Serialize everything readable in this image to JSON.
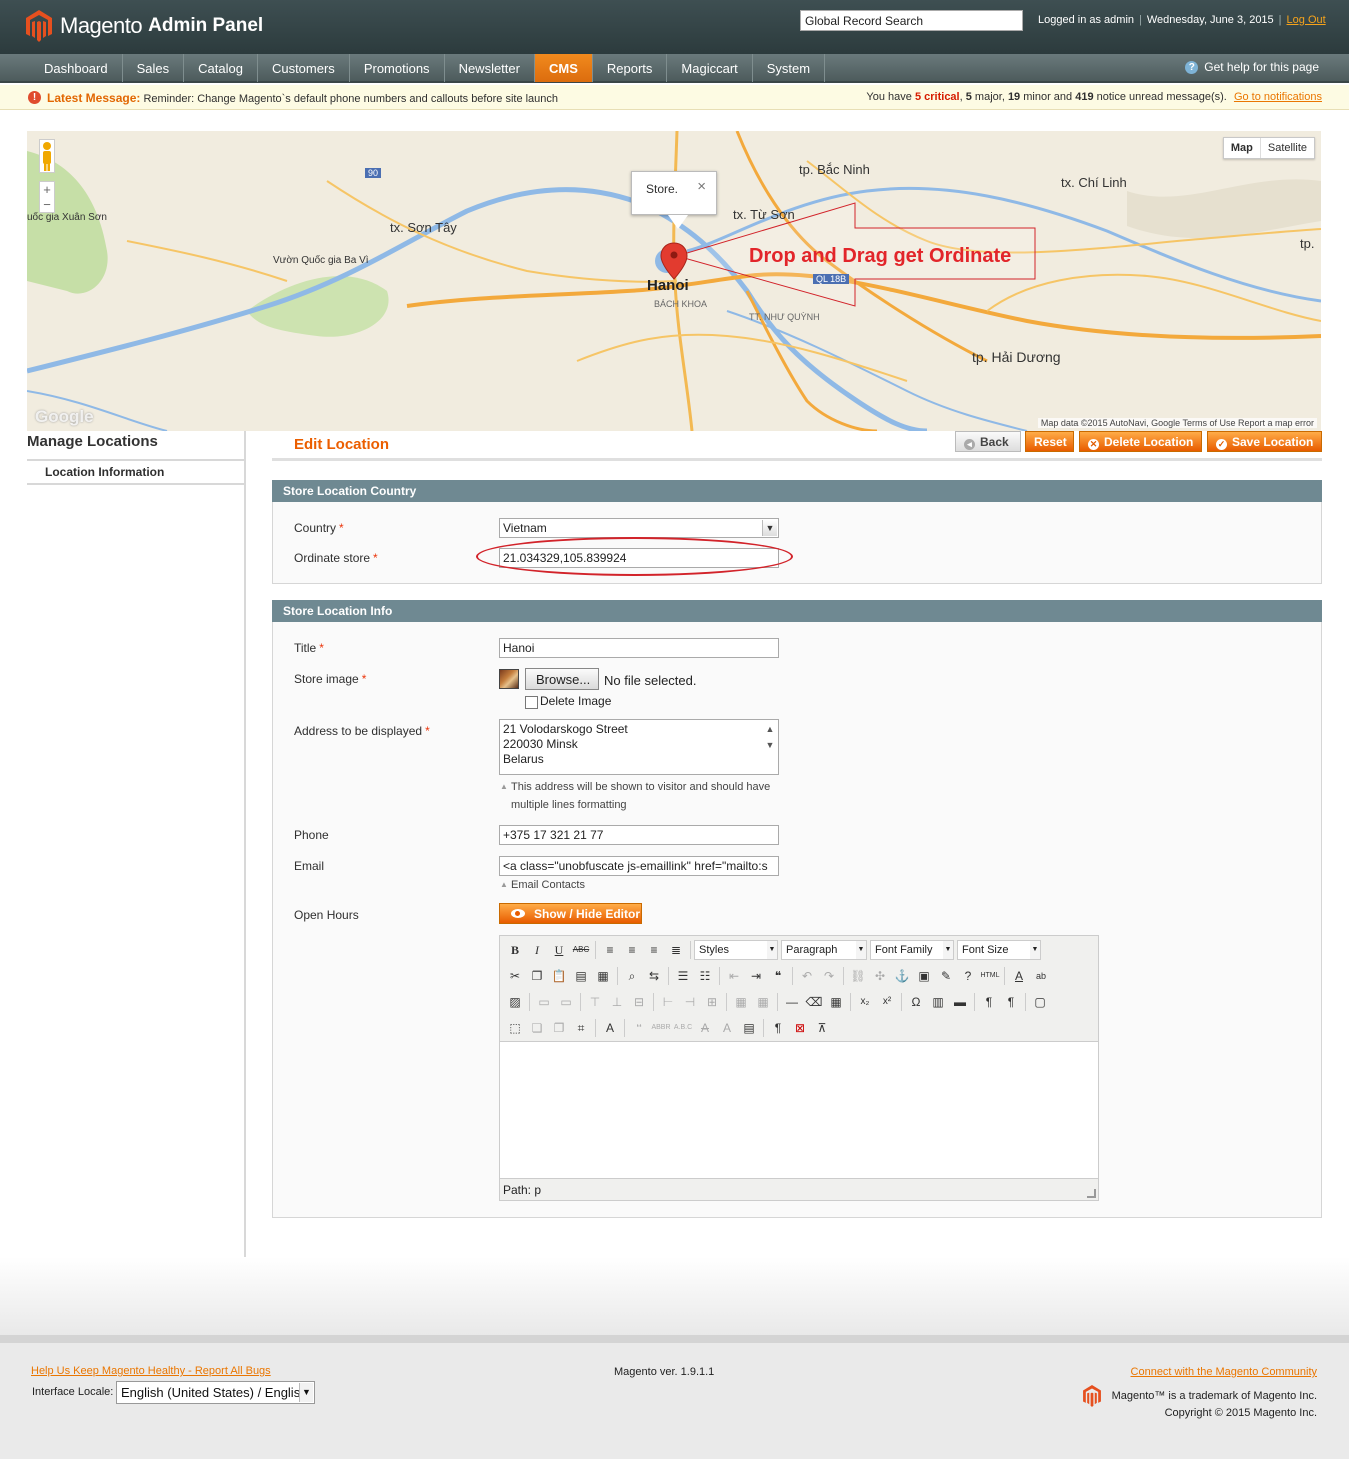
{
  "header": {
    "brand": "Magento",
    "brand_suffix": "Admin Panel",
    "search_value": "Global Record Search",
    "logged_in": "Logged in as admin",
    "date": "Wednesday, June 3, 2015",
    "logout": "Log Out"
  },
  "nav": {
    "items": [
      "Dashboard",
      "Sales",
      "Catalog",
      "Customers",
      "Promotions",
      "Newsletter",
      "CMS",
      "Reports",
      "Magiccart",
      "System"
    ],
    "active": "CMS",
    "help": "Get help for this page"
  },
  "notice": {
    "label": "Latest Message:",
    "message": "Reminder: Change Magento`s default phone numbers and callouts before site launch",
    "summary_prefix": "You have",
    "critical": "5 critical",
    "major": "5",
    "minor": "19",
    "notice": "419",
    "summary_text": "5 major, 19 minor and 419 notice unread message(s).",
    "link": "Go to notifications"
  },
  "map": {
    "places": [
      "tp. Bắc Ninh",
      "tx. Chí Linh",
      "tx. Sơn Tây",
      "tx. Từ Sơn",
      "Hanoi",
      "BÁCH KHOA",
      "Vườn Quốc gia Ba Vì",
      "uốc gia Xuân Sơn",
      "TT. NHƯ QUỲNH",
      "tp. Hải Dương",
      "tp."
    ],
    "road_badges": [
      "90",
      "QL 18B"
    ],
    "type_map": "Map",
    "type_satellite": "Satellite",
    "infowindow": "Store.",
    "annotation": "Drop and Drag get Ordinate",
    "footer": "Map data ©2015 AutoNavi, Google    Terms of Use    Report a map error",
    "google": "Google"
  },
  "sidebar": {
    "title": "Manage Locations",
    "tab": "Location Information"
  },
  "page": {
    "title": "Edit Location",
    "buttons": {
      "back": "Back",
      "reset": "Reset",
      "delete": "Delete Location",
      "save": "Save Location"
    }
  },
  "country_section": {
    "title": "Store Location Country",
    "country_label": "Country",
    "country_value": "Vietnam",
    "ordinate_label": "Ordinate store",
    "ordinate_value": "21.034329,105.839924"
  },
  "info_section": {
    "title": "Store Location Info",
    "title_label": "Title",
    "title_value": "Hanoi",
    "image_label": "Store image",
    "browse": "Browse...",
    "no_file": "No file selected.",
    "delete_image": "Delete Image",
    "address_label": "Address to be displayed",
    "address_lines": [
      "21 Volodarskogo Street",
      "220030  Minsk",
      "Belarus"
    ],
    "address_note": "This address will be shown to visitor and should have multiple lines formatting",
    "phone_label": "Phone",
    "phone_value": "+375 17 321 21 77",
    "email_label": "Email",
    "email_value": "<a class=\"unobfuscate js-emaillink\" href=\"mailto:s",
    "email_note": "Email Contacts",
    "hours_label": "Open Hours",
    "show_hide": "Show / Hide Editor"
  },
  "editor": {
    "styles": "Styles",
    "paragraph": "Paragraph",
    "font_family": "Font Family",
    "font_size": "Font Size",
    "path": "Path: p"
  },
  "footer": {
    "bugs": "Help Us Keep Magento Healthy - Report All Bugs",
    "locale_label": "Interface Locale:",
    "locale_value": "English (United States) / English",
    "version": "Magento ver. 1.9.1.1",
    "community": "Connect with the Magento Community",
    "trademark": "Magento™ is a trademark of Magento Inc.",
    "copyright": "Copyright © 2015 Magento Inc."
  },
  "colors": {
    "accent": "#eb5e00",
    "header": "#2c3b3d",
    "section": "#6f8992",
    "annotation": "#e2252a"
  }
}
